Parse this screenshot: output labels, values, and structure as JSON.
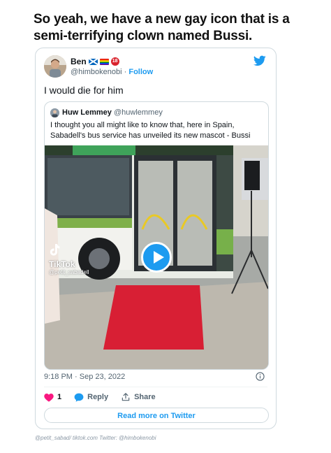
{
  "headline": "So yeah, we have a new gay icon that is a semi-terrifying clown named Bussi.",
  "tweet": {
    "author_name": "Ben",
    "author_handle": "@himbokenobi",
    "separator": "·",
    "follow_label": "Follow",
    "badge": "18",
    "text": "I would die for him",
    "timestamp": "9:18 PM · Sep 23, 2022",
    "like_count": "1",
    "reply_label": "Reply",
    "share_label": "Share",
    "read_more_label": "Read more on Twitter"
  },
  "quoted": {
    "author_name": "Huw Lemmey",
    "author_handle": "@huwlemmey",
    "text": "I thought you all might like to know that, here in Spain, Sabadell's bus service has unveiled its new mascot - Bussi"
  },
  "video": {
    "watermark_title": "TikTok",
    "watermark_handle": "@petit_sabadell"
  },
  "credit": "@petit_sabad/ tiktok.com Twitter: @himbokenobi",
  "colors": {
    "accent": "#1d9bf0",
    "like": "#f91880",
    "text_secondary": "#536471",
    "border": "#cfd9de"
  },
  "icons": [
    "twitter-bird-icon",
    "heart-icon",
    "reply-bubble-icon",
    "share-icon",
    "info-icon",
    "play-icon",
    "tiktok-logo-icon"
  ]
}
